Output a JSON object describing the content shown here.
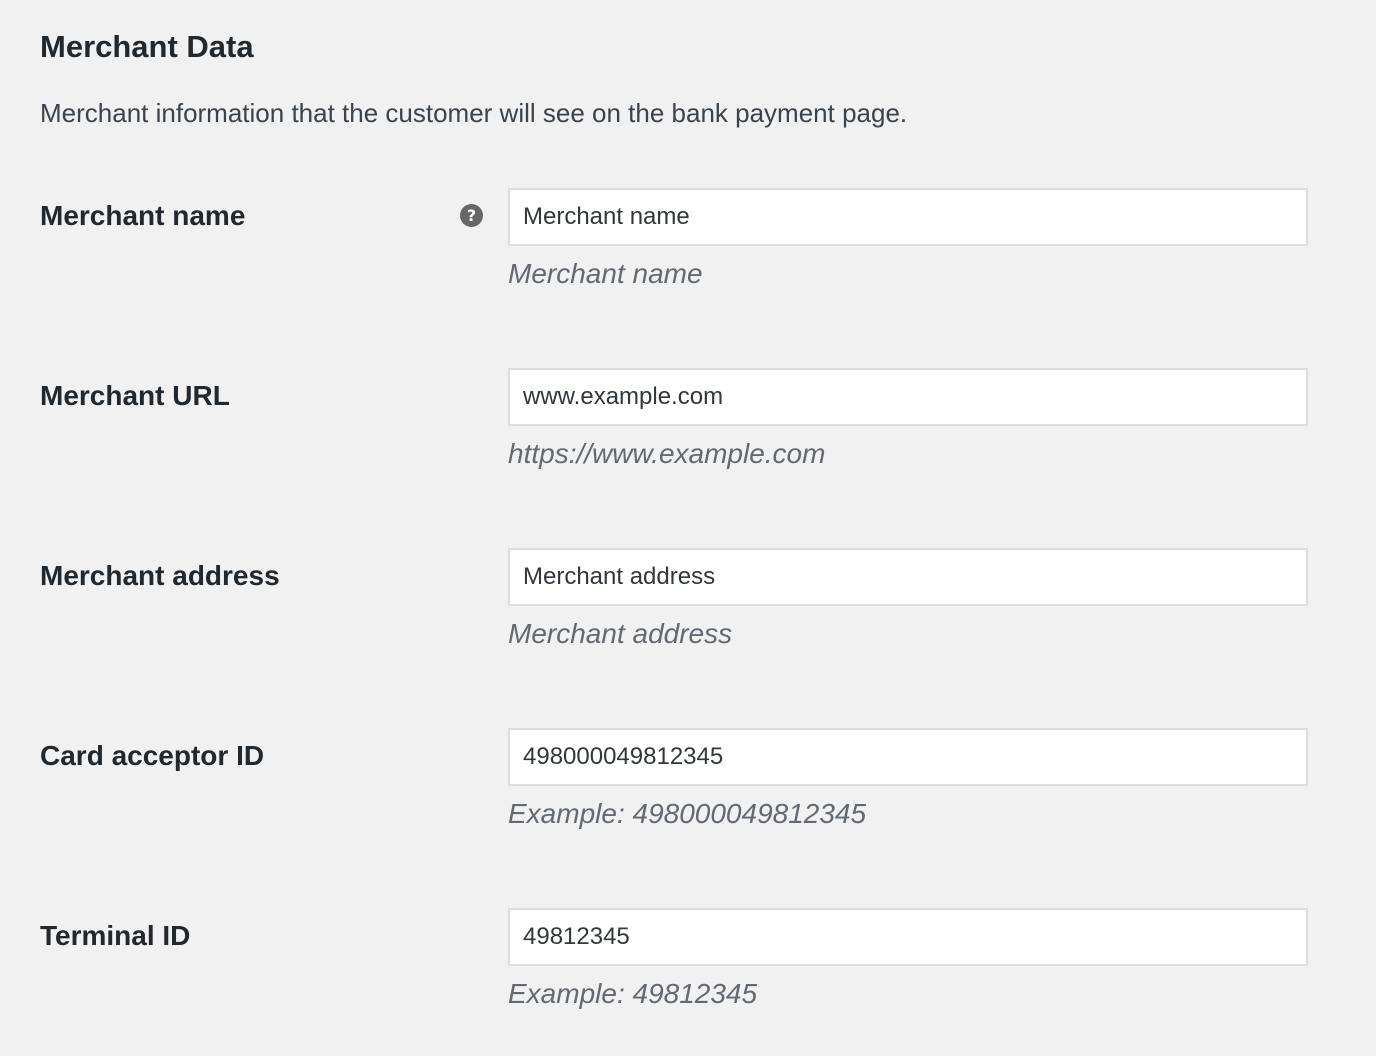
{
  "section": {
    "title": "Merchant Data",
    "description": "Merchant information that the customer will see on the bank payment page."
  },
  "fields": [
    {
      "label": "Merchant name",
      "has_help_tip": true,
      "help_icon": "question-circle-icon",
      "help_glyph": "?",
      "value": "Merchant name",
      "description": "Merchant name"
    },
    {
      "label": "Merchant URL",
      "has_help_tip": false,
      "value": "www.example.com",
      "description": "https://www.example.com"
    },
    {
      "label": "Merchant address",
      "has_help_tip": false,
      "value": "Merchant address",
      "description": "Merchant address"
    },
    {
      "label": "Card acceptor ID",
      "has_help_tip": false,
      "value": "498000049812345",
      "description": "Example: 498000049812345"
    },
    {
      "label": "Terminal ID",
      "has_help_tip": false,
      "value": "49812345",
      "description": "Example: 49812345"
    }
  ],
  "colors": {
    "page_background": "#f1f1f1",
    "text": "#23282d",
    "description_text": "#646970",
    "input_border": "#dddddd",
    "help_icon": "#666666"
  }
}
